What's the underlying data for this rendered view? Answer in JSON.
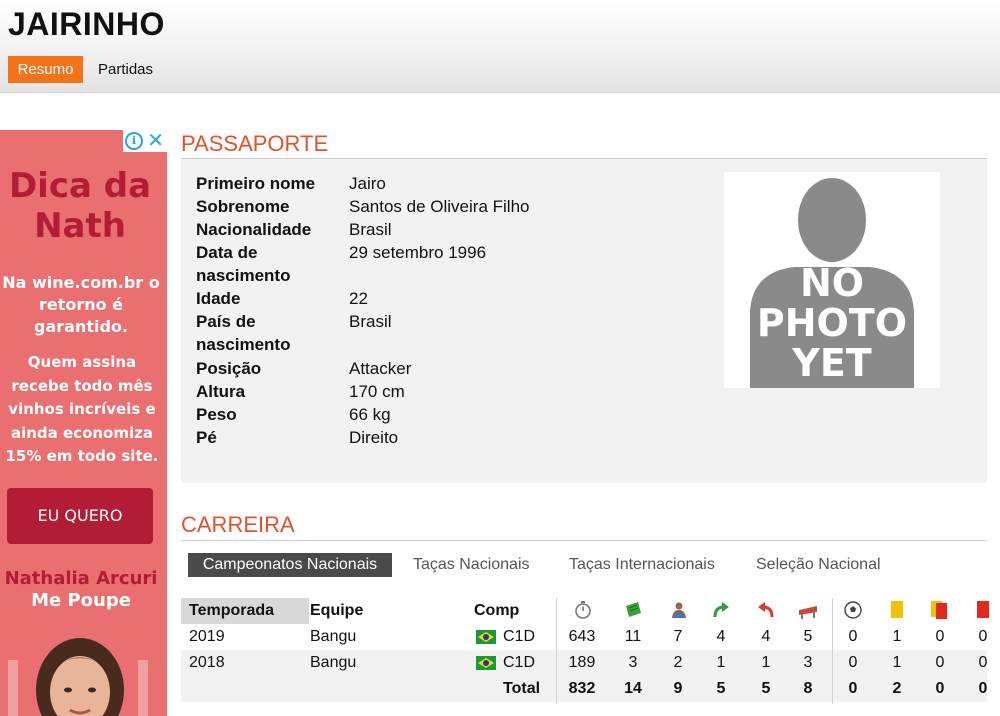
{
  "player": {
    "name": "JAIRINHO"
  },
  "tabs": [
    {
      "label": "Resumo",
      "active": true
    },
    {
      "label": "Partidas",
      "active": false
    }
  ],
  "ad": {
    "title": "Dica da Nath",
    "line1": "Na wine.com.br o retorno é garantido.",
    "line2": "Quem assina recebe todo mês vinhos incríveis e ainda economiza 15% em todo site.",
    "button": "EU QUERO",
    "name": "Nathalia Arcuri",
    "name2": "Me Poupe",
    "colors": {
      "background": "#e96f70",
      "accent": "#b31c35"
    },
    "icons": [
      "info-icon",
      "close-icon"
    ]
  },
  "passport": {
    "title": "PASSAPORTE",
    "rows": [
      {
        "label": "Primeiro nome",
        "value": "Jairo"
      },
      {
        "label": "Sobrenome",
        "value": "Santos de Oliveira Filho"
      },
      {
        "label": "Nacionalidade",
        "value": "Brasil"
      },
      {
        "label": "Data de nascimento",
        "value": "29 setembro 1996"
      },
      {
        "label": "Idade",
        "value": "22"
      },
      {
        "label": "País de nascimento",
        "value": "Brasil"
      },
      {
        "label": "Posição",
        "value": "Attacker"
      },
      {
        "label": "Altura",
        "value": "170 cm"
      },
      {
        "label": "Peso",
        "value": "66 kg"
      },
      {
        "label": "Pé",
        "value": "Direito"
      }
    ],
    "photo_text": [
      "NO",
      "PHOTO",
      "YET"
    ]
  },
  "career": {
    "title": "CARREIRA",
    "tabs": [
      "Campeonatos Nacionais",
      "Taças Nacionais",
      "Taças Internacionais",
      "Seleção Nacional"
    ],
    "headers": {
      "season": "Temporada",
      "team": "Equipe",
      "comp": "Comp"
    },
    "stat_icons": [
      "minutes-icon",
      "appearances-icon",
      "lineups-icon",
      "substitute-in-icon",
      "substitute-out-icon",
      "bench-icon",
      "goals-icon",
      "yellow-card-icon",
      "yellow-red-card-icon",
      "red-card-icon"
    ],
    "rows": [
      {
        "season": "2019",
        "team": "Bangu",
        "comp": "C1D",
        "stats": [
          "643",
          "11",
          "7",
          "4",
          "4",
          "5",
          "0",
          "1",
          "0",
          "0"
        ]
      },
      {
        "season": "2018",
        "team": "Bangu",
        "comp": "C1D",
        "stats": [
          "189",
          "3",
          "2",
          "1",
          "1",
          "3",
          "0",
          "1",
          "0",
          "0"
        ]
      }
    ],
    "total": {
      "label": "Total",
      "stats": [
        "832",
        "14",
        "9",
        "5",
        "5",
        "8",
        "0",
        "2",
        "0",
        "0"
      ]
    },
    "colors": {
      "section_title": "#e0532b",
      "active_tab": "#f27319"
    }
  }
}
